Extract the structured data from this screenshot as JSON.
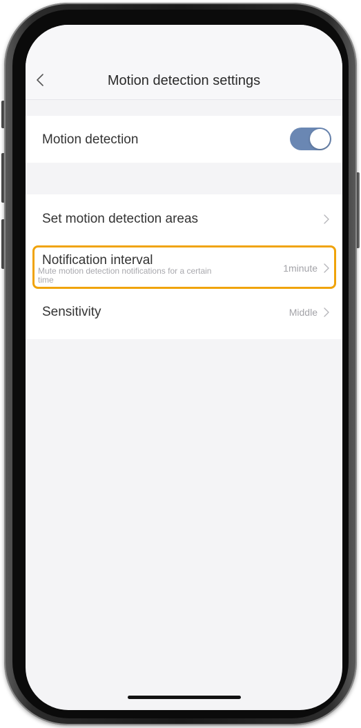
{
  "header": {
    "title": "Motion detection settings",
    "back_icon": "chevron-left-icon"
  },
  "motion_detection": {
    "label": "Motion detection",
    "enabled": true,
    "toggle_color": "#6a87b3"
  },
  "settings": {
    "areas": {
      "label": "Set motion detection areas"
    },
    "notification_interval": {
      "label": "Notification interval",
      "subtitle": "Mute motion detection notifications for a certain time",
      "value": "1minute"
    },
    "sensitivity": {
      "label": "Sensitivity",
      "value": "Middle"
    }
  },
  "highlight_color": "#f0a30a"
}
